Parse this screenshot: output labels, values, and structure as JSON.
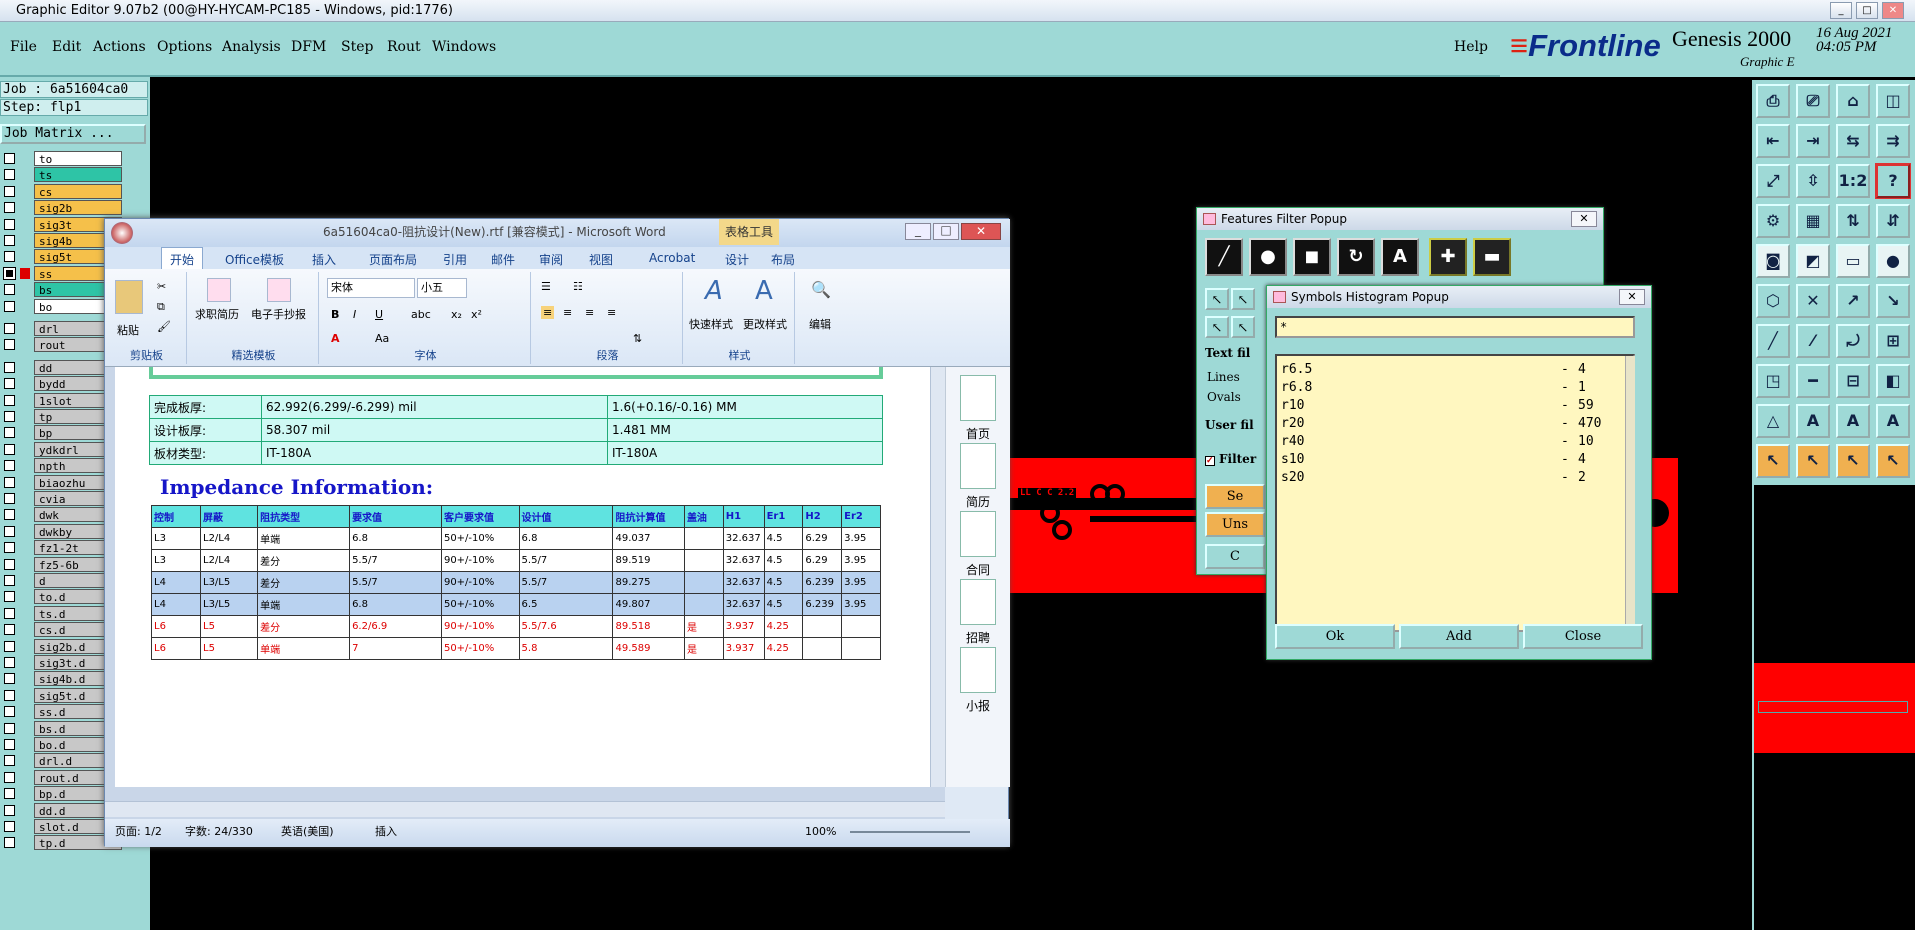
{
  "window": {
    "title": "Graphic Editor 9.07b2 (00@HY-HYCAM-PC185 - Windows, pid:1776)",
    "min": "_",
    "max": "□",
    "close": "✕"
  },
  "menu": {
    "items": [
      "File",
      "Edit",
      "Actions",
      "Options",
      "Analysis",
      "DFM",
      "Step",
      "Rout",
      "Windows"
    ],
    "help": "Help"
  },
  "brand": {
    "frontline": "Frontline",
    "genesis": "Genesis 2000",
    "date": "16 Aug 2021",
    "time": "04:05 PM",
    "sub": "Graphic E"
  },
  "left": {
    "job": "Job : 6a51604ca0",
    "step": "Step: flp1",
    "matrix": "Job Matrix ...",
    "layers": [
      {
        "name": "to",
        "color": "#ffffff"
      },
      {
        "name": "ts",
        "color": "#2ec4a6"
      },
      {
        "name": "cs",
        "color": "#f5c04a"
      },
      {
        "name": "sig2b",
        "color": "#f5c04a"
      },
      {
        "name": "sig3t",
        "color": "#f5c04a"
      },
      {
        "name": "sig4b",
        "color": "#f5c04a"
      },
      {
        "name": "sig5t",
        "color": "#f5c04a"
      },
      {
        "name": "ss",
        "color": "#f5c04a",
        "on": true
      },
      {
        "name": "bs",
        "color": "#2ec4a6"
      },
      {
        "name": "bo",
        "color": "#ffffff"
      },
      {
        "name": "drl",
        "color": "#c8c8c8"
      },
      {
        "name": "rout",
        "color": "#c8c8c8"
      },
      {
        "name": "dd",
        "color": "#c8c8c8"
      },
      {
        "name": "bydd",
        "color": "#c8c8c8"
      },
      {
        "name": "1slot",
        "color": "#c8c8c8"
      },
      {
        "name": "tp",
        "color": "#c8c8c8"
      },
      {
        "name": "bp",
        "color": "#c8c8c8"
      },
      {
        "name": "ydkdrl",
        "color": "#c8c8c8"
      },
      {
        "name": "npth",
        "color": "#c8c8c8"
      },
      {
        "name": "biaozhu",
        "color": "#c8c8c8"
      },
      {
        "name": "cvia",
        "color": "#c8c8c8"
      },
      {
        "name": "dwk",
        "color": "#c8c8c8"
      },
      {
        "name": "dwkby",
        "color": "#c8c8c8"
      },
      {
        "name": "fz1-2t",
        "color": "#c8c8c8"
      },
      {
        "name": "fz5-6b",
        "color": "#c8c8c8"
      },
      {
        "name": "d",
        "color": "#c8c8c8"
      },
      {
        "name": "to.d",
        "color": "#c8c8c8"
      },
      {
        "name": "ts.d",
        "color": "#c8c8c8"
      },
      {
        "name": "cs.d",
        "color": "#c8c8c8"
      },
      {
        "name": "sig2b.d",
        "color": "#c8c8c8"
      },
      {
        "name": "sig3t.d",
        "color": "#c8c8c8"
      },
      {
        "name": "sig4b.d",
        "color": "#c8c8c8"
      },
      {
        "name": "sig5t.d",
        "color": "#c8c8c8"
      },
      {
        "name": "ss.d",
        "color": "#c8c8c8"
      },
      {
        "name": "bs.d",
        "color": "#c8c8c8"
      },
      {
        "name": "bo.d",
        "color": "#c8c8c8"
      },
      {
        "name": "drl.d",
        "color": "#c8c8c8"
      },
      {
        "name": "rout.d",
        "color": "#c8c8c8"
      },
      {
        "name": "bp.d",
        "color": "#c8c8c8"
      },
      {
        "name": "dd.d",
        "color": "#c8c8c8"
      },
      {
        "name": "slot.d",
        "color": "#c8c8c8"
      },
      {
        "name": "tp.d",
        "color": "#c8c8c8"
      }
    ]
  },
  "word": {
    "title": "6a51604ca0-阻抗设计(New).rtf [兼容模式] - Microsoft Word",
    "table_tools": "表格工具",
    "tabs": [
      "开始",
      "Office模板",
      "插入",
      "页面布局",
      "引用",
      "邮件",
      "审阅",
      "视图",
      "Acrobat",
      "设计",
      "布局"
    ],
    "ribbon": {
      "paste": "粘贴",
      "clipboard": "剪贴板",
      "resume": "求职简历",
      "handcopy": "电子手抄报",
      "templates": "精选模板",
      "font_name": "宋体",
      "font_size": "小五",
      "font": "字体",
      "paragraph": "段落",
      "quick_style": "快速样式",
      "change_style": "更改样式",
      "styles": "样式",
      "edit": "编辑"
    },
    "board": [
      [
        "完成板厚:",
        "62.992(6.299/-6.299) mil",
        "1.6(+0.16/-0.16) MM"
      ],
      [
        "设计板厚:",
        "58.307 mil",
        "1.481 MM"
      ],
      [
        "板材类型:",
        "IT-180A",
        "IT-180A"
      ]
    ],
    "impedance_title": "Impedance Information:",
    "imp_header": [
      "控制",
      "屏蔽",
      "阻抗类型",
      "要求值",
      "客户要求值",
      "设计值",
      "阻抗计算值",
      "盖油",
      "H1",
      "Er1",
      "H2",
      "Er2"
    ],
    "imp_rows": [
      [
        "L3",
        "L2/L4",
        "单端",
        "6.8",
        "50+/-10%",
        "6.8",
        "49.037",
        "",
        "32.637",
        "4.5",
        "6.29",
        "3.95"
      ],
      [
        "L3",
        "L2/L4",
        "差分",
        "5.5/7",
        "90+/-10%",
        "5.5/7",
        "89.519",
        "",
        "32.637",
        "4.5",
        "6.29",
        "3.95"
      ],
      [
        "L4",
        "L3/L5",
        "差分",
        "5.5/7",
        "90+/-10%",
        "5.5/7",
        "89.275",
        "",
        "32.637",
        "4.5",
        "6.239",
        "3.95"
      ],
      [
        "L4",
        "L3/L5",
        "单端",
        "6.8",
        "50+/-10%",
        "6.5",
        "49.807",
        "",
        "32.637",
        "4.5",
        "6.239",
        "3.95"
      ],
      [
        "L6",
        "L5",
        "差分",
        "6.2/6.9",
        "90+/-10%",
        "5.5/7.6",
        "89.518",
        "是",
        "3.937",
        "4.25",
        "",
        ""
      ],
      [
        "L6",
        "L5",
        "单端",
        "7",
        "50+/-10%",
        "5.8",
        "49.589",
        "是",
        "3.937",
        "4.25",
        "",
        ""
      ]
    ],
    "side": [
      "首页",
      "简历",
      "合同",
      "招聘",
      "小报"
    ],
    "status": {
      "page": "页面: 1/2",
      "words": "字数: 24/330",
      "lang": "英语(美国)",
      "insert": "插入",
      "zoom": "100%"
    }
  },
  "features": {
    "title": "Features Filter Popup",
    "text_filter": "Text fil",
    "lines": "Lines",
    "ovals": "Ovals",
    "user_filter": "User fil",
    "filter": "Filter",
    "sel": "Se",
    "unsel": "Uns",
    "c": "C"
  },
  "histogram": {
    "title": "Symbols Histogram Popup",
    "filter": "*",
    "rows": [
      [
        "r6.5",
        "4"
      ],
      [
        "r6.8",
        "1"
      ],
      [
        "r10",
        "59"
      ],
      [
        "r20",
        "470"
      ],
      [
        "r40",
        "10"
      ],
      [
        "s10",
        "4"
      ],
      [
        "s20",
        "2"
      ]
    ],
    "ok": "Ok",
    "add": "Add",
    "close": "Close"
  },
  "pcb": {
    "label": "LL C C 2.2"
  }
}
